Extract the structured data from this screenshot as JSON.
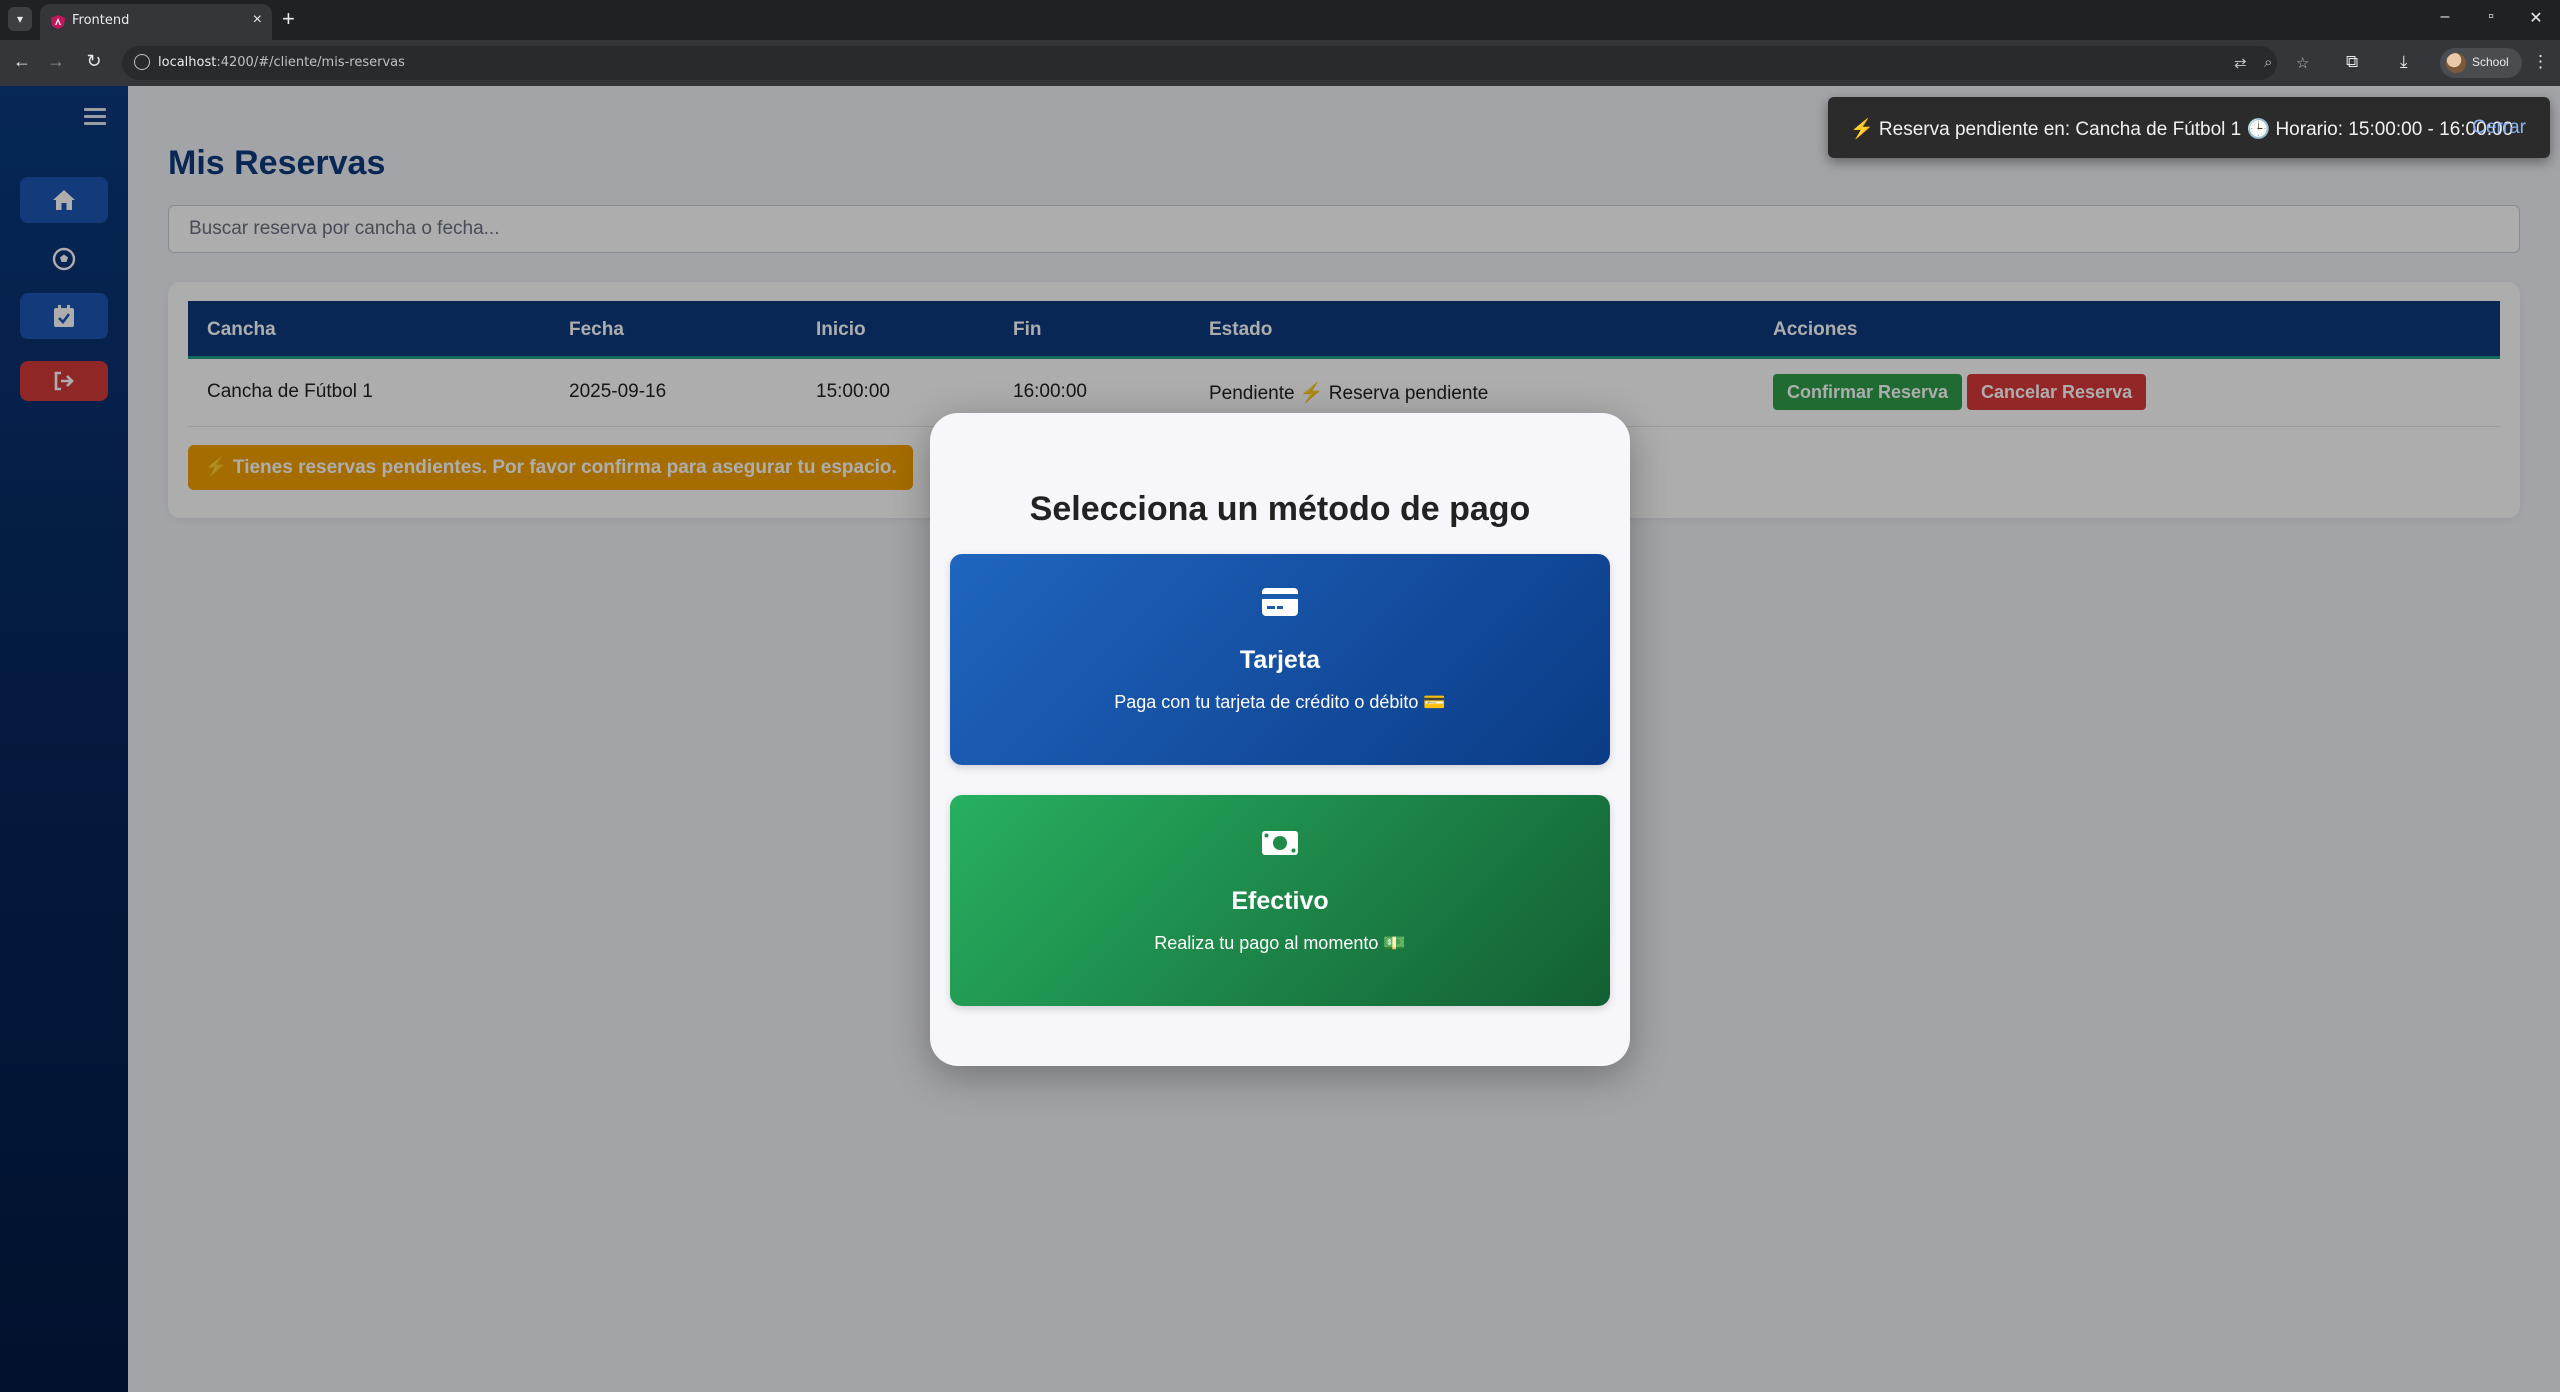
{
  "browser": {
    "tab_title": "Frontend",
    "url_host": "localhost",
    "url_rest": ":4200/#/cliente/mis-reservas",
    "profile_name": "School"
  },
  "colors": {
    "primary": "#0d3a7d",
    "confirm": "#2e9e4a",
    "cancel": "#d93a3a",
    "warning": "#f4a000"
  },
  "sidebar": {
    "items": [
      {
        "icon": "home-icon"
      },
      {
        "icon": "soccer-ball-icon"
      },
      {
        "icon": "calendar-check-icon"
      },
      {
        "icon": "logout-icon"
      }
    ]
  },
  "page": {
    "title": "Mis Reservas",
    "search_placeholder": "Buscar reserva por cancha o fecha..."
  },
  "table": {
    "headers": [
      "Cancha",
      "Fecha",
      "Inicio",
      "Fin",
      "Estado",
      "Acciones"
    ],
    "rows": [
      {
        "cancha": "Cancha de Fútbol 1",
        "fecha": "2025-09-16",
        "inicio": "15:00:00",
        "fin": "16:00:00",
        "estado": "Pendiente ⚡ Reserva pendiente",
        "confirm_label": "Confirmar Reserva",
        "cancel_label": "Cancelar Reserva"
      }
    ]
  },
  "alert": {
    "text": "⚡ Tienes reservas pendientes. Por favor confirma para asegurar tu espacio."
  },
  "toast": {
    "message": "⚡ Reserva pendiente en: Cancha de Fútbol 1 🕒 Horario: 15:00:00 - 16:00:00",
    "close_label": "Cerrar"
  },
  "modal": {
    "title": "Selecciona un método de pago",
    "options": [
      {
        "label": "Tarjeta",
        "description": "Paga con tu tarjeta de crédito o débito 💳",
        "icon": "credit-card-icon"
      },
      {
        "label": "Efectivo",
        "description": "Realiza tu pago al momento 💵",
        "icon": "money-bill-icon"
      }
    ]
  }
}
